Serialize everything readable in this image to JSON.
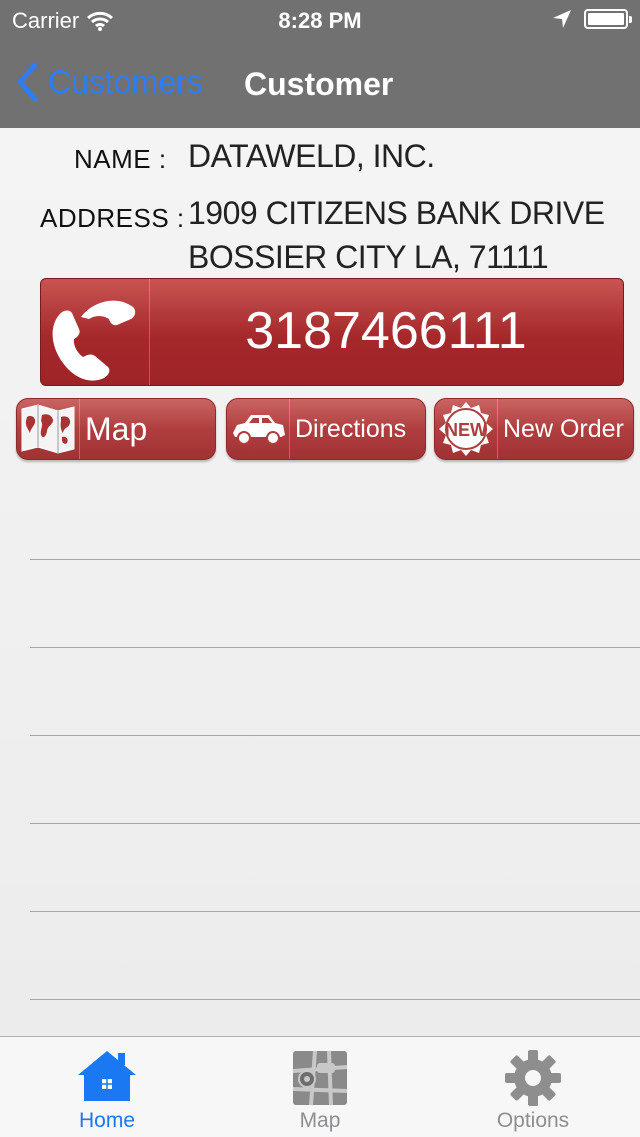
{
  "status_bar": {
    "carrier": "Carrier",
    "time": "8:28 PM"
  },
  "nav": {
    "back_label": "Customers",
    "title": "Customer"
  },
  "customer": {
    "name_label": "NAME :",
    "name": "DATAWELD, INC.",
    "address_label": "ADDRESS :",
    "address_line1": "1909 CITIZENS BANK DRIVE",
    "address_line2": "BOSSIER CITY LA, 71111",
    "phone": "3187466111"
  },
  "actions": {
    "map_label": "Map",
    "directions_label": "Directions",
    "new_order_label": "New Order",
    "new_badge": "NEW"
  },
  "tabs": [
    {
      "label": "Home",
      "icon": "home-icon",
      "active": true
    },
    {
      "label": "Map",
      "icon": "map-icon",
      "active": false
    },
    {
      "label": "Options",
      "icon": "gear-icon",
      "active": false
    }
  ],
  "colors": {
    "accent": "#1a78f2",
    "button_red": "#a5282b",
    "header": "#717171"
  }
}
